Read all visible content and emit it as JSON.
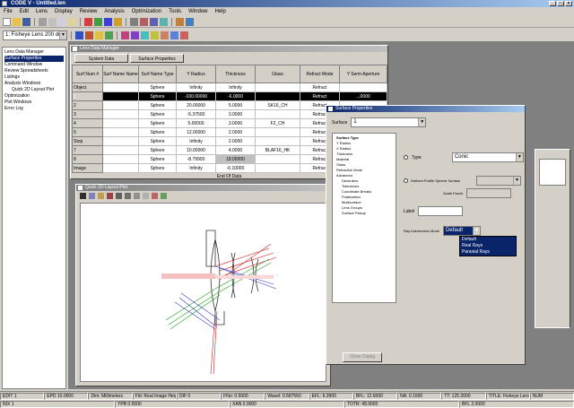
{
  "window": {
    "title": "CODE V - Untitled.len"
  },
  "menu": [
    "File",
    "Edit",
    "Lens",
    "Display",
    "Review",
    "Analysis",
    "Optimization",
    "Tools",
    "Window",
    "Help"
  ],
  "toolbar2": {
    "lens_combo": "1: Fisheye Lens 200 deg"
  },
  "tree": {
    "items": [
      "Lens Data Manager",
      "Surface Properties",
      "Command Window",
      "Review Spreadsheets",
      "Listings",
      "Analysis Windows",
      "Quick 2D Layout Plot",
      "Optimization",
      "Plot Windows",
      "Error Log"
    ]
  },
  "lde": {
    "title": "Lens Data Manager",
    "tabs": [
      "System Data",
      "Surface Properties"
    ],
    "headers": [
      "Surf Num #",
      "Surf Name Name",
      "Surf Name Type",
      "Y Radius",
      "Thickness",
      "Glass",
      "Refract Mode",
      "Y Semi-Aperture"
    ],
    "rows": [
      [
        "Object",
        "",
        "Sphere",
        "Infinity",
        "Infinity",
        "",
        "Refract",
        ""
      ],
      [
        "1",
        "",
        "Sphere",
        "-100.00000",
        "-6.0000",
        "",
        "Refract",
        "...0000"
      ],
      [
        "2",
        "",
        "Sphere",
        "20.00000",
        "5.0000",
        "SK16_CH",
        "Refract",
        ""
      ],
      [
        "3",
        "",
        "Sphere",
        "-5.37500",
        "3.0000",
        "",
        "Refract",
        ""
      ],
      [
        "4",
        "",
        "Sphere",
        "5.00000",
        "3.0000",
        "F2_CH",
        "Refract",
        ""
      ],
      [
        "5",
        "",
        "Sphere",
        "12.00000",
        "2.0000",
        "",
        "Refract",
        ""
      ],
      [
        "Stop",
        "",
        "Sphere",
        "Infinity",
        "2.0000",
        "",
        "Refract",
        ""
      ],
      [
        "7",
        "",
        "Sphere",
        "10.00000",
        "4.0000",
        "BLAF16_HK",
        "Refract",
        ""
      ],
      [
        "8",
        "",
        "Sphere",
        "-8.79900",
        "18.00000",
        "",
        "Refract",
        ""
      ],
      [
        "Image",
        "",
        "Sphere",
        "Infinity",
        "-0.10000",
        "",
        "Refract",
        ""
      ]
    ],
    "footer": "End Of Data"
  },
  "plot": {
    "title": "Quick 2D Layout Plot"
  },
  "props": {
    "title": "Surface Properties",
    "surface_label": "Surface",
    "surface_value": "1",
    "categories": [
      "Surface Type",
      "Y Radius",
      "X Radius",
      "Thickness",
      "Material",
      "Glass",
      "Refractive Mode",
      "Advanced",
      "Decenters",
      "Tolerances",
      "Coordinate Breaks",
      "Polarization",
      "Multisurface",
      "Lens Groups",
      "Surface Pickup"
    ],
    "type_label": "Type",
    "type_value": "Conic",
    "profile_label": "Defined Profile Sphere Surface",
    "scale_label": "Scale Factor",
    "label_label": "Label",
    "ray_label": "Ray Intersection Mode",
    "ray_value": "Default",
    "ray_options": [
      "Default",
      "Real Rays",
      "Paraxial Rays"
    ],
    "ok_button": "Close Dialog"
  },
  "status": {
    "row1": [
      "EDIT 1",
      "EPD 10.0000",
      "Dim: Millimeters",
      "Fld: Real Image Heights",
      "DIF 0",
      "FNo: 0.5000",
      "Wavel: 0.587560",
      "EFL: 6.3900",
      "BFL: 12.6000",
      "NA: 0.1000",
      "TT: 125.3000",
      "TITLE: Fisheye Lens 200 deg",
      "NUM"
    ],
    "row2": [
      "NIX 1",
      "YPB 0.0000",
      "XAN 0.0000",
      "TOTR: 48.9000",
      "BFL 2.0000"
    ]
  },
  "colors": {
    "accent": "#0a246a",
    "ray_red": "#cc2020",
    "ray_green": "#20a020",
    "ray_blue": "#3a3ad0"
  }
}
